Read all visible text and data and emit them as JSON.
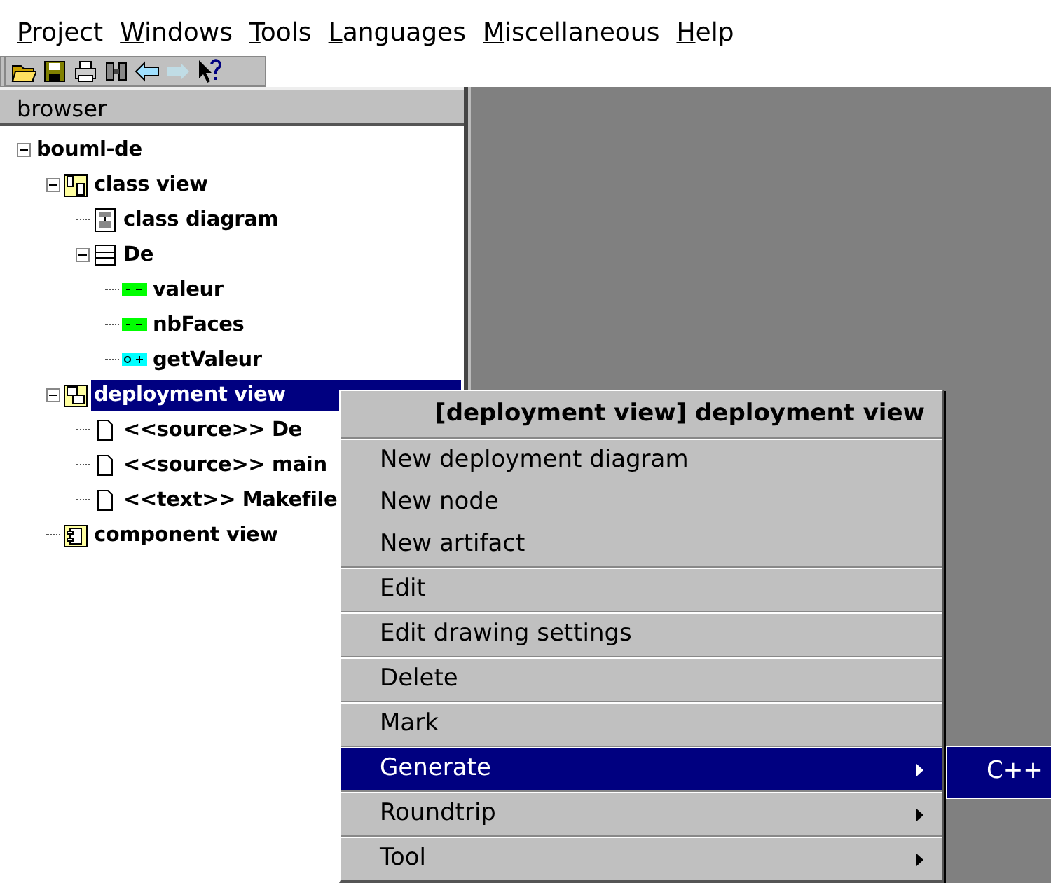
{
  "menu_bar": [
    "Project",
    "Windows",
    "Tools",
    "Languages",
    "Miscellaneous",
    "Help"
  ],
  "toolbar": [
    {
      "kind": "open",
      "disabled": false
    },
    {
      "kind": "save",
      "disabled": false
    },
    {
      "kind": "print",
      "disabled": false
    },
    {
      "kind": "find",
      "disabled": false
    },
    {
      "kind": "back",
      "disabled": false
    },
    {
      "kind": "forward",
      "disabled": true
    },
    {
      "kind": "whatsthis",
      "disabled": false
    }
  ],
  "browser": {
    "title": "browser",
    "tree": [
      {
        "label": "bouml-de",
        "expanded": true,
        "selected": false,
        "children": [
          {
            "label": "class view",
            "kind": "classview",
            "expanded": true,
            "selected": false,
            "children": [
              {
                "label": "class diagram",
                "kind": "diagram",
                "selected": false
              },
              {
                "label": "De",
                "kind": "class",
                "expanded": true,
                "selected": false,
                "children": [
                  {
                    "label": "valeur",
                    "kind": "attribute",
                    "selected": false
                  },
                  {
                    "label": "nbFaces",
                    "kind": "attribute",
                    "selected": false
                  },
                  {
                    "label": "getValeur",
                    "kind": "operation",
                    "selected": false
                  }
                ]
              }
            ]
          },
          {
            "label": "deployment view",
            "kind": "deploymentview",
            "expanded": true,
            "selected": true,
            "children": [
              {
                "label": "<<source>> De",
                "kind": "artifact",
                "selected": false
              },
              {
                "label": "<<source>> main",
                "kind": "artifact",
                "selected": false
              },
              {
                "label": "<<text>> Makefile",
                "kind": "artifact",
                "selected": false
              }
            ]
          },
          {
            "label": "component view",
            "kind": "componentview",
            "selected": false
          }
        ]
      }
    ]
  },
  "context_menu": {
    "title": "[deployment view] deployment view",
    "groups": [
      [
        {
          "label": "New deployment diagram",
          "selected": false,
          "submenu": false
        },
        {
          "label": "New node",
          "selected": false,
          "submenu": false
        },
        {
          "label": "New artifact",
          "selected": false,
          "submenu": false
        }
      ],
      [
        {
          "label": "Edit",
          "selected": false,
          "submenu": false
        }
      ],
      [
        {
          "label": "Edit drawing settings",
          "selected": false,
          "submenu": false
        }
      ],
      [
        {
          "label": "Delete",
          "selected": false,
          "submenu": false
        }
      ],
      [
        {
          "label": "Mark",
          "selected": false,
          "submenu": false
        }
      ],
      [
        {
          "label": "Generate",
          "selected": true,
          "submenu": true
        }
      ],
      [
        {
          "label": "Roundtrip",
          "selected": false,
          "submenu": true
        }
      ],
      [
        {
          "label": "Tool",
          "selected": false,
          "submenu": true
        }
      ]
    ]
  },
  "submenu": {
    "items": [
      {
        "label": "C++",
        "selected": true
      }
    ]
  }
}
